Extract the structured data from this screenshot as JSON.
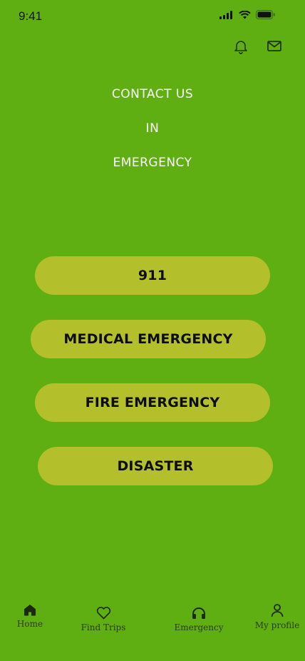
{
  "status_bar": {
    "time": "9:41",
    "icons": [
      "signal-icon",
      "wifi-icon",
      "battery-icon"
    ]
  },
  "header": {
    "icons": [
      "bell-icon",
      "mail-icon"
    ]
  },
  "title": {
    "line1": "CONTACT US",
    "line2": "IN",
    "line3": "EMERGENCY"
  },
  "buttons": {
    "b911": "911",
    "medical": "MEDICAL EMERGENCY",
    "fire": "FIRE EMERGENCY",
    "disaster": "DISASTER"
  },
  "nav": {
    "home": "Home",
    "find_trips": "Find Trips",
    "emergency": "Emergency",
    "profile": "My profile"
  },
  "colors": {
    "background": "#5faf12",
    "button": "#b3bf2b",
    "title_text": "#ffffff"
  }
}
